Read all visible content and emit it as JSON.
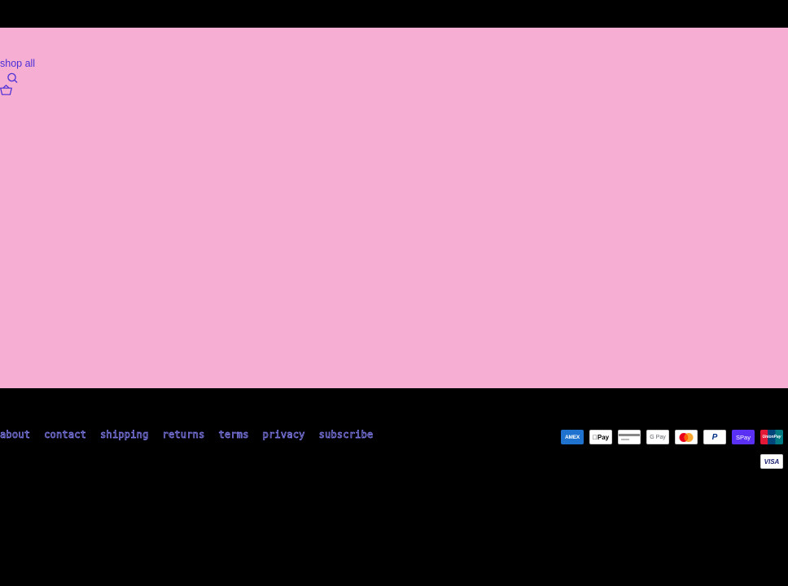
{
  "header": {
    "nav_link": "shop all",
    "search_icon": "search-icon",
    "cart_icon": "basket-icon"
  },
  "colors": {
    "main_background": "#f6aed3",
    "page_background": "#000000",
    "link": "#4b2fd6",
    "footer_link_outline": "#8a86ff"
  },
  "footer": {
    "links": [
      "about",
      "contact",
      "shipping",
      "returns",
      "terms",
      "privacy",
      "subscribe"
    ],
    "payment_methods": [
      {
        "name": "American Express",
        "icon": "amex-icon",
        "text": "AMEX"
      },
      {
        "name": "Apple Pay",
        "icon": "apple-pay-icon",
        "text": "Pay"
      },
      {
        "name": "Generic card",
        "icon": "generic-card-icon",
        "text": ""
      },
      {
        "name": "Google Pay",
        "icon": "google-pay-icon",
        "text": "G Pay"
      },
      {
        "name": "Mastercard",
        "icon": "mastercard-icon",
        "text": ""
      },
      {
        "name": "PayPal",
        "icon": "paypal-icon",
        "text": "P"
      },
      {
        "name": "Shop Pay",
        "icon": "shop-pay-icon",
        "text": "Pay"
      },
      {
        "name": "Union Pay",
        "icon": "union-pay-icon",
        "text": "UnionPay"
      },
      {
        "name": "Visa",
        "icon": "visa-icon",
        "text": "VISA"
      }
    ]
  }
}
